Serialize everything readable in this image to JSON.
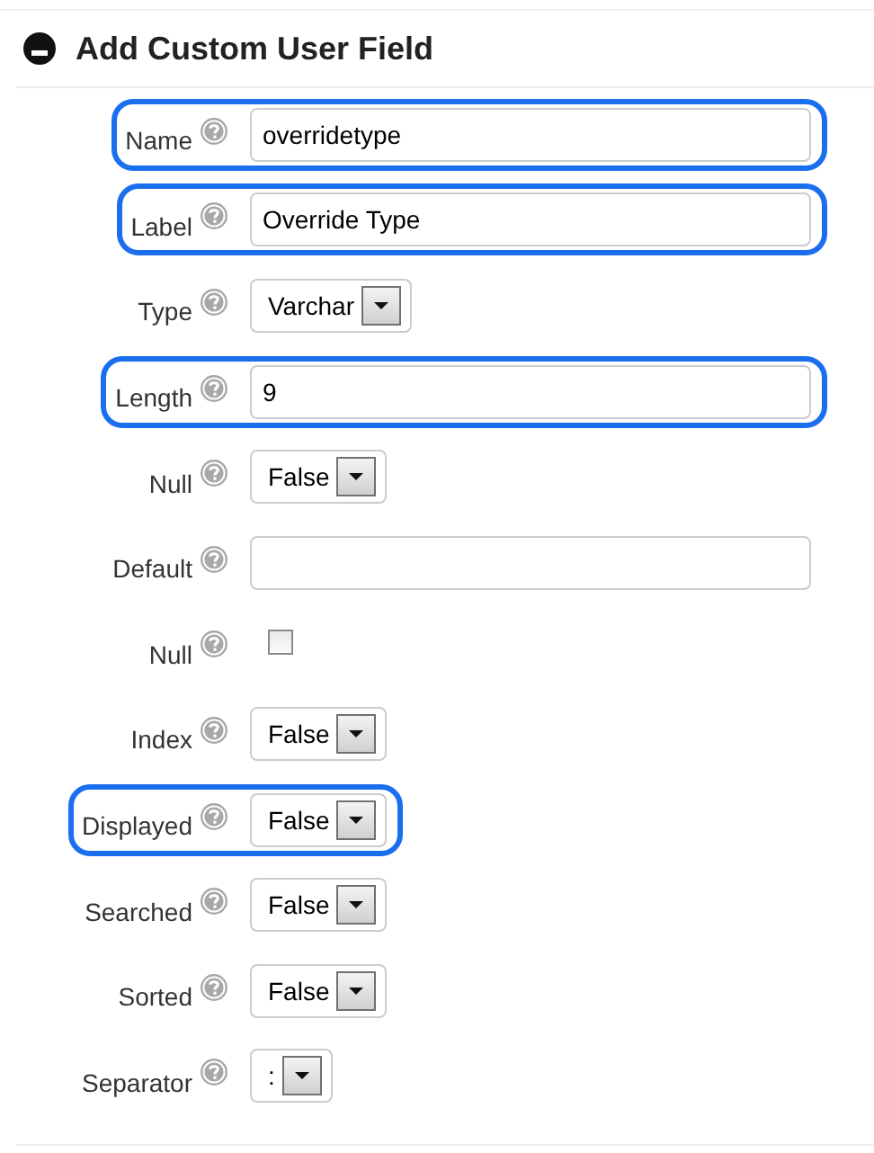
{
  "section": {
    "title": "Add Custom User Field",
    "expanded": true
  },
  "fields": [
    {
      "label": "Name",
      "kind": "text",
      "value": "overridetype",
      "highlighted": true
    },
    {
      "label": "Label",
      "kind": "text",
      "value": "Override Type",
      "highlighted": true
    },
    {
      "label": "Type",
      "kind": "select",
      "value": "Varchar",
      "highlighted": false
    },
    {
      "label": "Length",
      "kind": "text",
      "value": "9",
      "highlighted": true
    },
    {
      "label": "Null",
      "kind": "select",
      "value": "False",
      "highlighted": false
    },
    {
      "label": "Default",
      "kind": "text",
      "highlighted": false
    },
    {
      "label": "Null",
      "kind": "checkbox",
      "checked": false,
      "highlighted": false
    },
    {
      "label": "Index",
      "kind": "select",
      "value": "False",
      "highlighted": false
    },
    {
      "label": "Displayed",
      "kind": "select",
      "value": "False",
      "highlighted": true
    },
    {
      "label": "Searched",
      "kind": "select",
      "value": "False",
      "highlighted": false
    },
    {
      "label": "Sorted",
      "kind": "select",
      "value": "False",
      "highlighted": false
    },
    {
      "label": "Separator",
      "kind": "select",
      "value": ":",
      "highlighted": false
    }
  ]
}
